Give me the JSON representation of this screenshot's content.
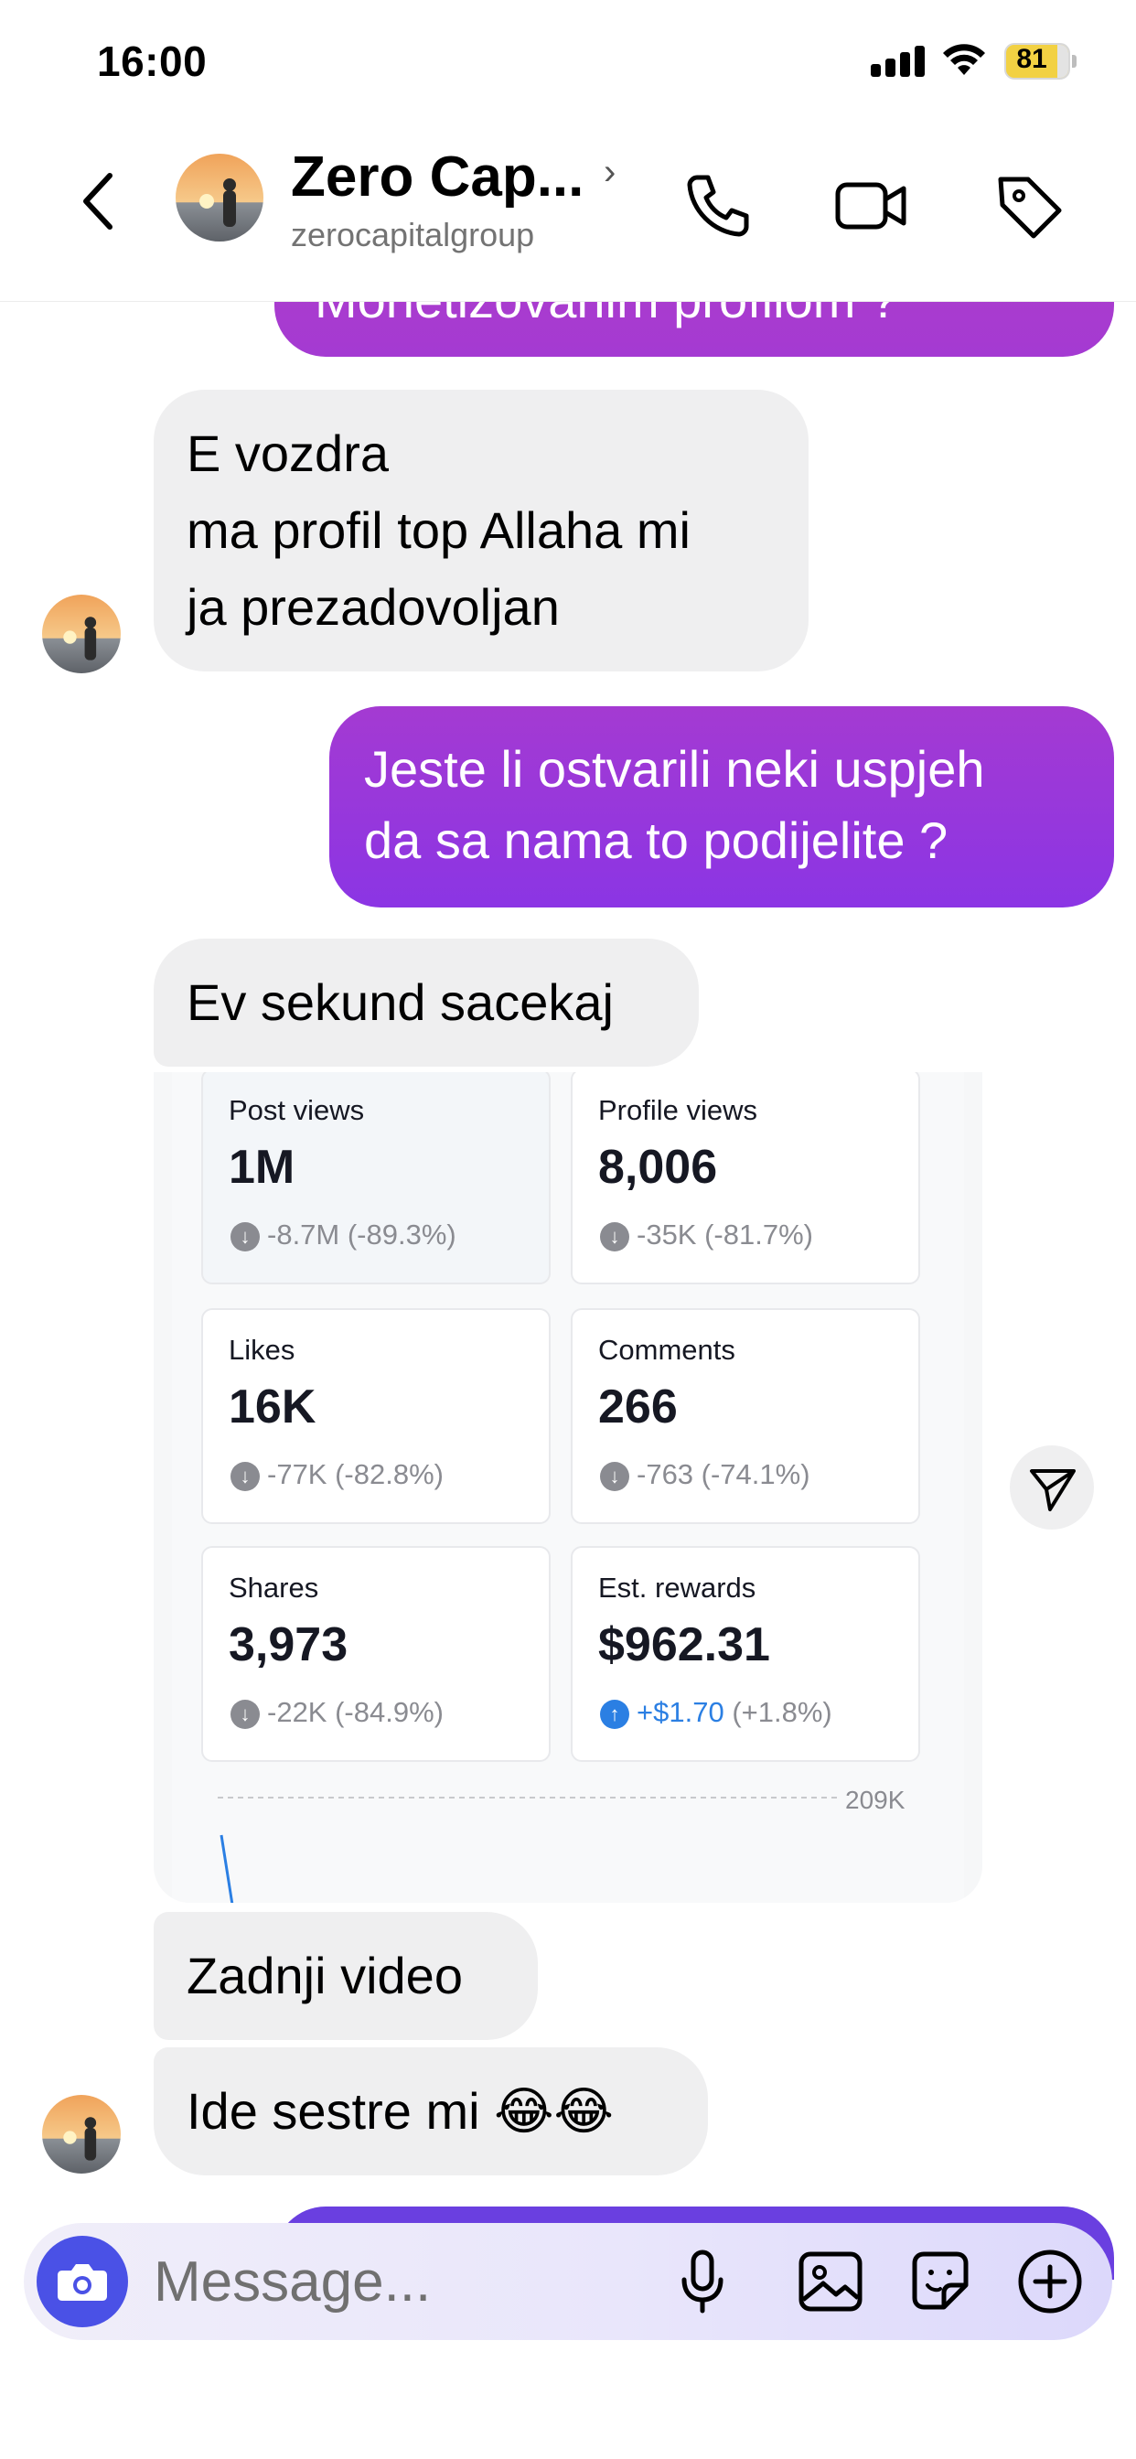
{
  "status_bar": {
    "time": "16:00",
    "battery": "81"
  },
  "header": {
    "contact_name": "Zero Cap...",
    "contact_handle": "zerocapitalgroup",
    "icons": [
      "back-icon",
      "phone-icon",
      "video-camera-icon",
      "tag-icon"
    ]
  },
  "messages": {
    "partial_sent": "Monetizovanim profilom ?",
    "received_1": [
      "E vozdra",
      "ma profil top Allaha mi",
      "ja prezadovoljan"
    ],
    "sent_1": [
      "Jeste li ostvarili neki uspjeh",
      "da sa nama to podijelite ?"
    ],
    "received_2": "Ev sekund sacekaj",
    "received_3": "Zadnji video",
    "received_4": "Ide sestre mi 😂😂"
  },
  "shared_screenshot": {
    "stats": [
      {
        "label": "Post views",
        "value": "1M",
        "change": "-8.7M (-89.3%)",
        "direction": "down"
      },
      {
        "label": "Profile views",
        "value": "8,006",
        "change": "-35K (-81.7%)",
        "direction": "down"
      },
      {
        "label": "Likes",
        "value": "16K",
        "change": "-77K (-82.8%)",
        "direction": "down"
      },
      {
        "label": "Comments",
        "value": "266",
        "change": "-763 (-74.1%)",
        "direction": "down"
      },
      {
        "label": "Shares",
        "value": "3,973",
        "change": "-22K (-84.9%)",
        "direction": "down"
      },
      {
        "label": "Est. rewards",
        "value": "$962.31",
        "change_main": "+$1.70",
        "change_pct": "(+1.8%)",
        "direction": "up"
      }
    ],
    "chart_axis_label": "209K"
  },
  "composer": {
    "placeholder": "Message...",
    "icons": [
      "camera-icon",
      "microphone-icon",
      "gallery-icon",
      "sticker-icon",
      "plus-icon"
    ]
  },
  "colors": {
    "sent_bubble": "#8b35e4",
    "received_bubble": "#efeff0",
    "camera_button": "#4a51e6",
    "battery": "#f2d143",
    "up_change": "#2b7fe3"
  }
}
